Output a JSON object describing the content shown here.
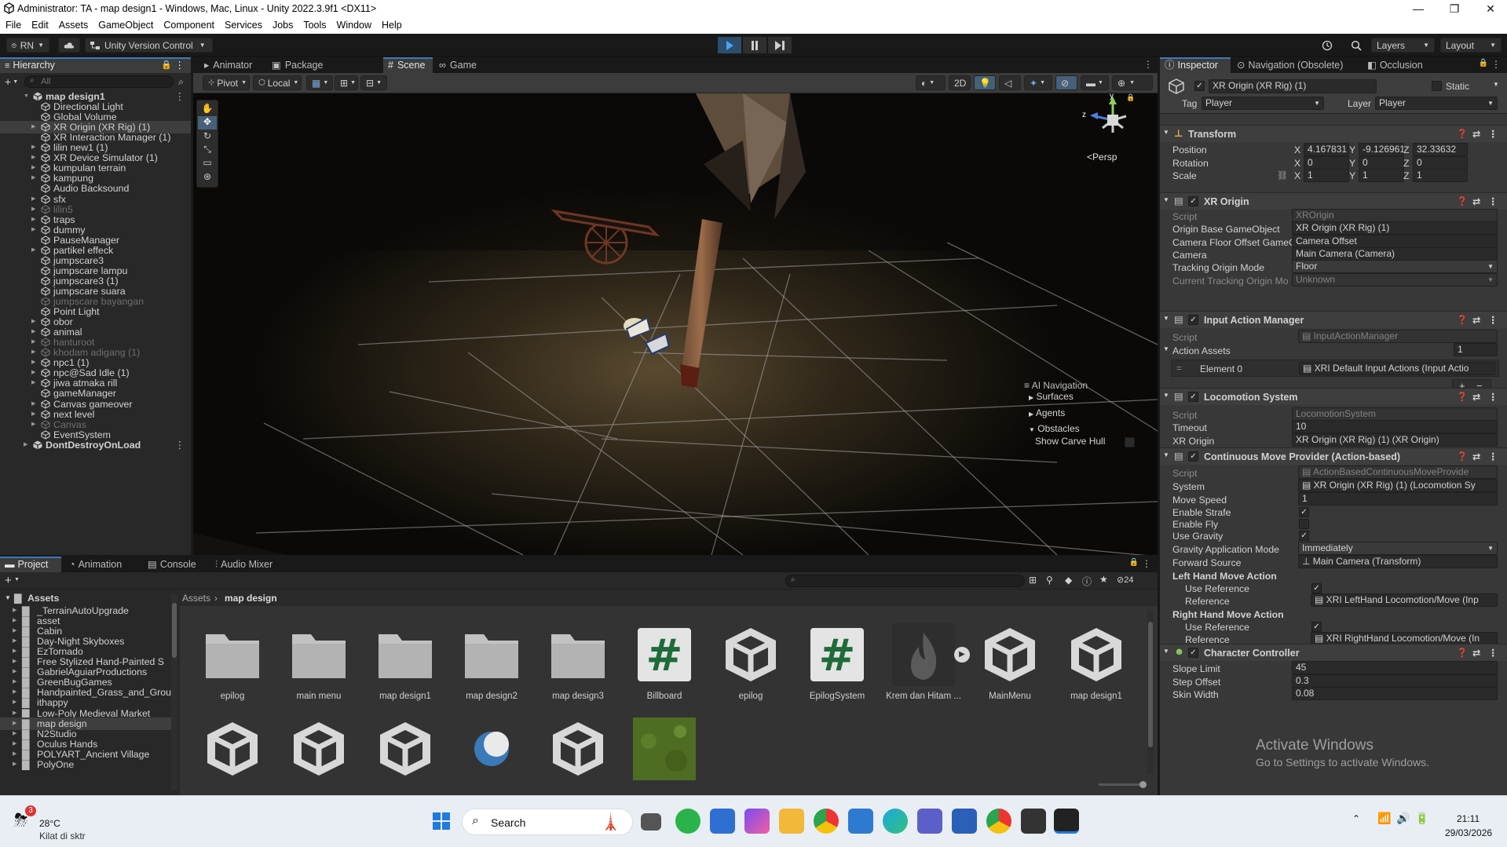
{
  "window": {
    "title": "Administrator: TA - map design1 - Windows, Mac, Linux - Unity 2022.3.9f1 <DX11>",
    "controls": [
      "—",
      "❐",
      "✕"
    ]
  },
  "menu": [
    "File",
    "Edit",
    "Assets",
    "GameObject",
    "Component",
    "Services",
    "Jobs",
    "Tools",
    "Window",
    "Help"
  ],
  "toolbar": {
    "account": "RN",
    "version_control": "Unity Version Control",
    "layers": "Layers",
    "layout": "Layout"
  },
  "hierarchy": {
    "tab": "Hierarchy",
    "search_placeholder": "All",
    "items": [
      {
        "label": "map design1",
        "indent": 0,
        "arrow": "down",
        "scene": true
      },
      {
        "label": "Directional Light",
        "indent": 1
      },
      {
        "label": "Global Volume",
        "indent": 1
      },
      {
        "label": "XR Origin (XR Rig) (1)",
        "indent": 1,
        "arrow": "right",
        "selected": true
      },
      {
        "label": "XR Interaction Manager (1)",
        "indent": 1
      },
      {
        "label": "lilin new1 (1)",
        "indent": 1,
        "arrow": "right"
      },
      {
        "label": "XR Device Simulator (1)",
        "indent": 1,
        "arrow": "right"
      },
      {
        "label": "kumpulan terrain",
        "indent": 1,
        "arrow": "right"
      },
      {
        "label": "kampung",
        "indent": 1,
        "arrow": "right"
      },
      {
        "label": "Audio Backsound",
        "indent": 1
      },
      {
        "label": "sfx",
        "indent": 1,
        "arrow": "right"
      },
      {
        "label": "lilin5",
        "indent": 1,
        "arrow": "right",
        "dim": true
      },
      {
        "label": "traps",
        "indent": 1,
        "arrow": "right"
      },
      {
        "label": "dummy",
        "indent": 1,
        "arrow": "right"
      },
      {
        "label": "PauseManager",
        "indent": 1
      },
      {
        "label": "partikel effeck",
        "indent": 1,
        "arrow": "right"
      },
      {
        "label": "jumpscare3",
        "indent": 1
      },
      {
        "label": "jumpscare lampu",
        "indent": 1
      },
      {
        "label": "jumpscare3 (1)",
        "indent": 1
      },
      {
        "label": "jumpscare suara",
        "indent": 1
      },
      {
        "label": "jumpscare bayangan",
        "indent": 1,
        "dim": true
      },
      {
        "label": "Point Light",
        "indent": 1
      },
      {
        "label": "obor",
        "indent": 1,
        "arrow": "right"
      },
      {
        "label": "animal",
        "indent": 1,
        "arrow": "right"
      },
      {
        "label": "hanturoot",
        "indent": 1,
        "arrow": "right",
        "dim": true
      },
      {
        "label": "khodam adigang (1)",
        "indent": 1,
        "arrow": "right",
        "dim": true
      },
      {
        "label": "npc1 (1)",
        "indent": 1,
        "arrow": "right"
      },
      {
        "label": "npc@Sad Idle (1)",
        "indent": 1,
        "arrow": "right"
      },
      {
        "label": "jiwa atmaka rill",
        "indent": 1,
        "arrow": "right"
      },
      {
        "label": "gameManager",
        "indent": 1
      },
      {
        "label": "Canvas gameover",
        "indent": 1,
        "arrow": "right"
      },
      {
        "label": "next level",
        "indent": 1,
        "arrow": "right"
      },
      {
        "label": "Canvas",
        "indent": 1,
        "arrow": "right",
        "dim": true
      },
      {
        "label": "EventSystem",
        "indent": 1
      },
      {
        "label": "DontDestroyOnLoad",
        "indent": 0,
        "arrow": "right",
        "scene": true
      }
    ]
  },
  "scene_tabs": [
    "Animator",
    "Package Manager",
    "Scene",
    "Game"
  ],
  "scene_toolbar": {
    "pivot": "Pivot",
    "local": "Local",
    "mode2d": "2D"
  },
  "gizmo": {
    "y": "y",
    "z": "z",
    "persp": "Persp"
  },
  "ai_nav": {
    "title": "AI Navigation",
    "items": [
      "Surfaces",
      "Agents",
      "Obstacles"
    ],
    "show_carve": "Show Carve Hull"
  },
  "inspector": {
    "tabs": [
      "Inspector",
      "Navigation (Obsolete)",
      "Occlusion"
    ],
    "object_name": "XR Origin (XR Rig) (1)",
    "static_label": "Static",
    "tag_label": "Tag",
    "tag": "Player",
    "layer_label": "Layer",
    "layer": "Player",
    "transform": {
      "title": "Transform",
      "rows": [
        {
          "label": "Position",
          "x": "4.167831",
          "y": "-9.126961e",
          "z": "32.33632"
        },
        {
          "label": "Rotation",
          "x": "0",
          "y": "0",
          "z": "0"
        },
        {
          "label": "Scale",
          "x": "1",
          "y": "1",
          "z": "1"
        }
      ]
    },
    "xr_origin": {
      "title": "XR Origin",
      "rows": [
        {
          "label": "Script",
          "value": "XROrigin",
          "dim": true
        },
        {
          "label": "Origin Base GameObject",
          "value": "XR Origin (XR Rig) (1)"
        },
        {
          "label": "Camera Floor Offset GameO",
          "value": "Camera Offset"
        },
        {
          "label": "Camera",
          "value": "Main Camera (Camera)"
        },
        {
          "label": "Tracking Origin Mode",
          "value": "Floor",
          "dropdown": true
        },
        {
          "label": "Current Tracking Origin Mo",
          "value": "Unknown",
          "dropdown": true,
          "dim": true
        }
      ]
    },
    "input_action_manager": {
      "title": "Input Action Manager",
      "script": "InputActionManager",
      "action_assets_label": "Action Assets",
      "action_assets_count": "1",
      "element_label": "Element 0",
      "element_value": "XRI Default Input Actions (Input Actio"
    },
    "locomotion_system": {
      "title": "Locomotion System",
      "rows": [
        {
          "label": "Script",
          "value": "LocomotionSystem",
          "dim": true
        },
        {
          "label": "Timeout",
          "value": "10"
        },
        {
          "label": "XR Origin",
          "value": "XR Origin (XR Rig) (1) (XR Origin)"
        }
      ]
    },
    "continuous_move": {
      "title": "Continuous Move Provider (Action-based)",
      "script": "ActionBasedContinuousMoveProvide",
      "system": "XR Origin (XR Rig) (1) (Locomotion Sy",
      "move_speed": "1",
      "enable_strafe": true,
      "enable_fly": false,
      "use_gravity": true,
      "gravity_mode": "Immediately",
      "forward_source": "Main Camera (Transform)",
      "labels": {
        "script": "Script",
        "system": "System",
        "move_speed": "Move Speed",
        "enable_strafe": "Enable Strafe",
        "enable_fly": "Enable Fly",
        "use_gravity": "Use Gravity",
        "gravity_mode": "Gravity Application Mode",
        "forward_source": "Forward Source",
        "left_hand": "Left Hand Move Action",
        "right_hand": "Right Hand Move Action",
        "use_reference": "Use Reference",
        "reference": "Reference"
      },
      "left_reference": "XRI LeftHand Locomotion/Move (Inp",
      "right_reference": "XRI RightHand Locomotion/Move (In"
    },
    "character_controller": {
      "title": "Character Controller",
      "rows": [
        {
          "label": "Slope Limit",
          "value": "45"
        },
        {
          "label": "Step Offset",
          "value": "0.3"
        },
        {
          "label": "Skin Width",
          "value": "0.08"
        }
      ]
    }
  },
  "watermark": {
    "line1": "Activate Windows",
    "line2": "Go to Settings to activate Windows."
  },
  "project": {
    "tabs": [
      "Project",
      "Animation",
      "Console",
      "Audio Mixer"
    ],
    "hidden_count": "24",
    "breadcrumb": [
      "Assets",
      "map design"
    ],
    "tree_root": "Assets",
    "folders": [
      "_TerrainAutoUpgrade",
      "asset",
      "Cabin",
      "Day-Night Skyboxes",
      "EzTornado",
      "Free Stylized Hand-Painted S",
      "GabrielAguiarProductions",
      "GreenBugGames",
      "Handpainted_Grass_and_Grou",
      "ithappy",
      "Low-Poly Medieval Market",
      "map design",
      "N2Studio",
      "Oculus Hands",
      "POLYART_Ancient Village",
      "PolyOne"
    ],
    "selected_folder": "map design",
    "assets": [
      {
        "name": "epilog",
        "kind": "folder"
      },
      {
        "name": "main menu",
        "kind": "folder"
      },
      {
        "name": "map design1",
        "kind": "folder"
      },
      {
        "name": "map design2",
        "kind": "folder"
      },
      {
        "name": "map design3",
        "kind": "folder"
      },
      {
        "name": "Billboard",
        "kind": "script"
      },
      {
        "name": "epilog",
        "kind": "scene"
      },
      {
        "name": "EpilogSystem",
        "kind": "script"
      },
      {
        "name": "Krem dan Hitam ...",
        "kind": "fire"
      },
      {
        "name": "MainMenu",
        "kind": "scene"
      },
      {
        "name": "map design1",
        "kind": "scene"
      },
      {
        "name": "",
        "kind": "scene"
      },
      {
        "name": "",
        "kind": "scene"
      },
      {
        "name": "",
        "kind": "scene"
      },
      {
        "name": "",
        "kind": "sphere"
      },
      {
        "name": "",
        "kind": "scene"
      },
      {
        "name": "",
        "kind": "grass"
      }
    ]
  },
  "taskbar": {
    "weather_temp": "28°C",
    "weather_desc": "Kilat di sktr",
    "weather_badge": "3",
    "search": "Search",
    "time": "21:11",
    "date": "29/03/2026"
  },
  "colors": {
    "accent": "#3a79bb",
    "play_icon": "#4aa3f0",
    "script_green": "#1e6b39",
    "selection": "#2c5d87"
  }
}
